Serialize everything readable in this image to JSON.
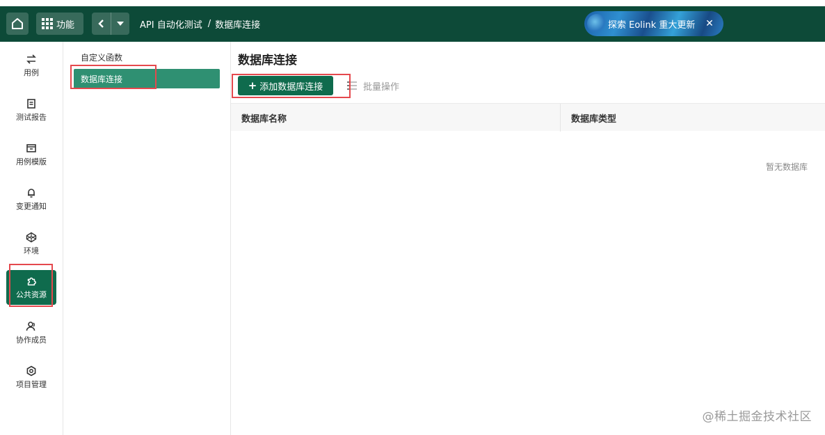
{
  "header": {
    "function_label": "功能",
    "breadcrumb": {
      "project": "API 自动化测试",
      "separator": "/",
      "current": "数据库连接"
    },
    "promo": {
      "text": "探索 Eolink 重大更新",
      "close": "✕"
    }
  },
  "rail": {
    "items": [
      {
        "label": "用例",
        "icon": "swap-icon"
      },
      {
        "label": "测试报告",
        "icon": "report-icon"
      },
      {
        "label": "用例模版",
        "icon": "template-icon"
      },
      {
        "label": "变更通知",
        "icon": "bell-icon"
      },
      {
        "label": "环境",
        "icon": "codepen-icon"
      },
      {
        "label": "公共资源",
        "icon": "puzzle-icon",
        "active": true
      },
      {
        "label": "协作成员",
        "icon": "members-icon"
      },
      {
        "label": "项目管理",
        "icon": "gear-icon"
      }
    ]
  },
  "submenu": {
    "items": [
      {
        "label": "自定义函数"
      },
      {
        "label": "数据库连接",
        "active": true
      }
    ]
  },
  "main": {
    "title": "数据库连接",
    "add_button": "添加数据库连接",
    "add_plus": "+",
    "batch_label": "批量操作",
    "table": {
      "columns": [
        "数据库名称",
        "数据库类型"
      ],
      "empty_text": "暂无数据库"
    }
  },
  "watermark": "@稀土掘金技术社区",
  "colors": {
    "header_bg": "#0d4a38",
    "accent": "#0f6b4d",
    "submenu_active": "#2f9072",
    "annotation": "#e5484d"
  }
}
